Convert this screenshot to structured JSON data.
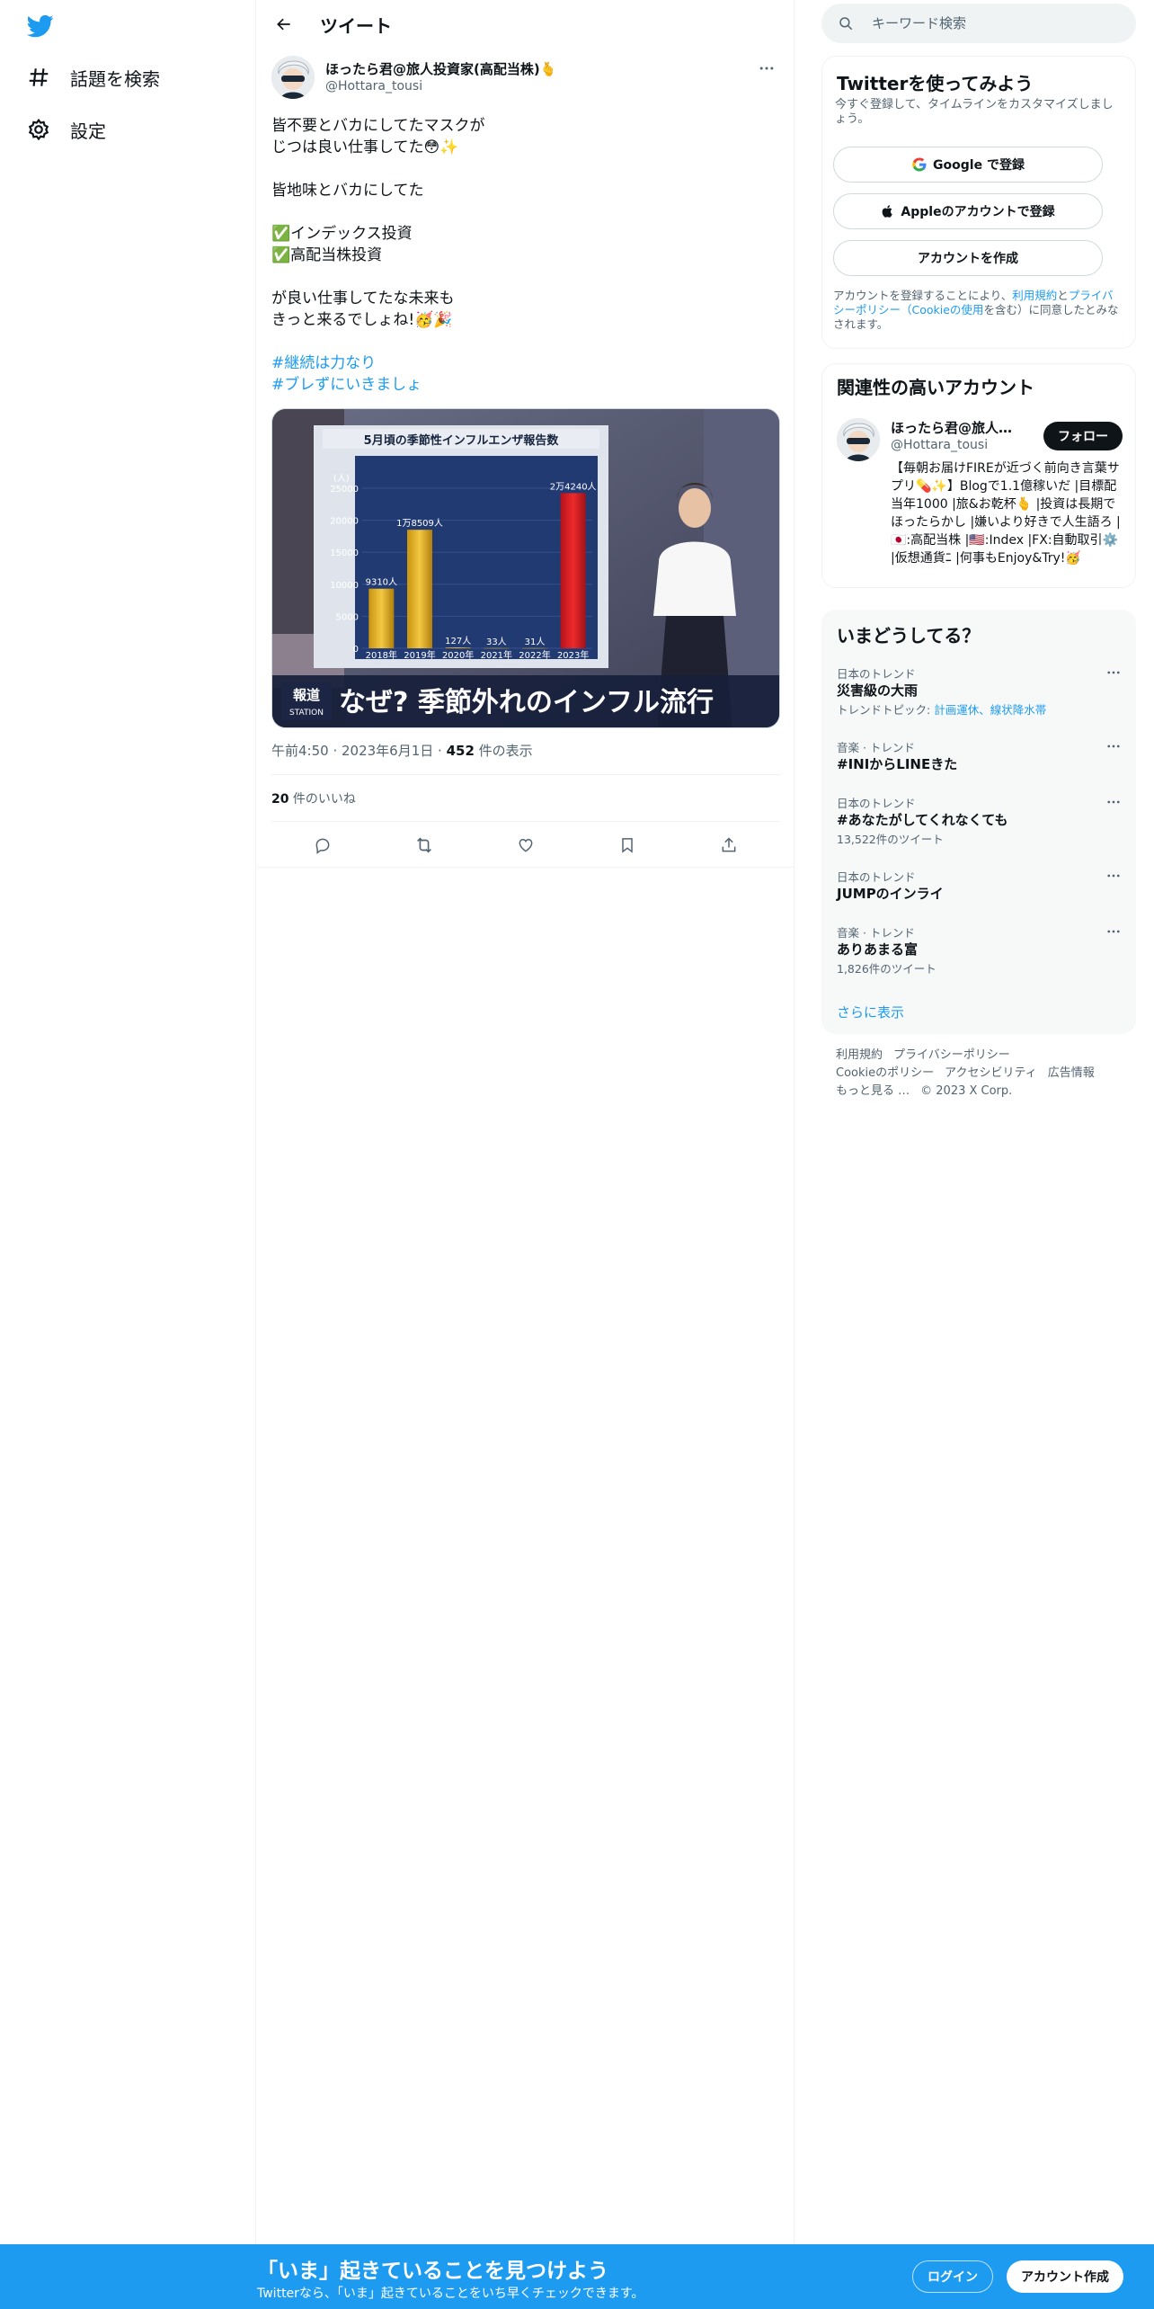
{
  "nav": {
    "explore_label": "話題を検索",
    "settings_label": "設定"
  },
  "header": {
    "title": "ツイート"
  },
  "tweet": {
    "author_name": "ほったら君@旅人投資家(高配当株)🫰",
    "author_handle": "@Hottara_tousi",
    "lines": [
      "皆不要とバカにしてたマスクが",
      "じつは良い仕事してた😳✨",
      "",
      "皆地味とバカにしてた",
      "",
      "✅インデックス投資",
      "✅高配当株投資",
      "",
      "が良い仕事してたな未来も",
      "きっと来るでしょね!🥳🎉",
      ""
    ],
    "hashtags": [
      "#継続は力なり",
      "#ブレずにいきましょ"
    ],
    "media": {
      "chart_title": "5月頃の季節性インフルエンザ報告数",
      "y_unit": "(人)",
      "y_ticks": [
        "25000",
        "20000",
        "15000",
        "10000",
        "5000",
        "0"
      ],
      "years": [
        "2018年",
        "2019年",
        "2020年",
        "2021年",
        "2022年",
        "2023年"
      ],
      "labels": [
        "9310人",
        "1万8509人",
        "127人",
        "33人",
        "31人",
        "2万4240人"
      ],
      "values": [
        9310,
        18509,
        127,
        33,
        31,
        24240
      ],
      "ymax": 25000,
      "banner_logo_top": "報道",
      "banner_logo_bottom": "STATION",
      "banner_text": "なぜ? 季節外れのインフル流行"
    },
    "time": "午前4:50",
    "date": "2023年6月1日",
    "views": "452",
    "views_label": " 件の表示",
    "likes": "20",
    "likes_label": " 件のいいね"
  },
  "search": {
    "placeholder": "キーワード検索"
  },
  "signup": {
    "title": "Twitterを使ってみよう",
    "subtitle": "今すぐ登録して、タイムラインをカスタマイズしましょう。",
    "google": "Google で登録",
    "apple": "Appleのアカウントで登録",
    "create": "アカウントを作成",
    "terms_prefix": "アカウントを登録することにより、",
    "terms_link1": "利用規約",
    "terms_mid": "と",
    "terms_link2": "プライバシーポリシー（Cookieの使用",
    "terms_suffix": "を含む）に同意したとみなされます。"
  },
  "related": {
    "title": "関連性の高いアカウント",
    "name": "ほったら君@旅人投...",
    "handle": "@Hottara_tousi",
    "follow": "フォロー",
    "bio": "【毎朝お届けFIREが近づく前向き言葉サプリ💊✨】Blogで1.1億稼いだ |目標配当年1000 |旅&お乾杯🫰 |投資は長期でほったらかし |嫌いより好きで人生語ろ | 🇯🇵:高配当株 |🇺🇸:Index |FX:自動取引⚙️ |仮想通貨ﾆ |何事もEnjoy&Try!🥳"
  },
  "trends": {
    "title": "いまどうしてる？",
    "items": [
      {
        "context": "日本のトレンド",
        "name": "災害級の大雨",
        "extra_prefix": "トレンドトピック: ",
        "extra_link": "計画運休、線状降水帯"
      },
      {
        "context": "音楽 · トレンド",
        "name": "#INIからLINEきた"
      },
      {
        "context": "日本のトレンド",
        "name": "#あなたがしてくれなくても",
        "extra": "13,522件のツイート"
      },
      {
        "context": "日本のトレンド",
        "name": "JUMPのインライ"
      },
      {
        "context": "音楽 · トレンド",
        "name": "ありあまる富",
        "extra": "1,826件のツイート"
      }
    ],
    "show_more": "さらに表示"
  },
  "footer": {
    "links": [
      "利用規約",
      "プライバシーポリシー",
      "Cookieのポリシー",
      "アクセシビリティ",
      "広告情報",
      "もっと見る …"
    ],
    "copyright": "© 2023 X Corp."
  },
  "bottom": {
    "headline": "「いま」起きていることを見つけよう",
    "sub": "Twitterなら、「いま」起きていることをいち早くチェックできます。",
    "login": "ログイン",
    "signup": "アカウント作成"
  },
  "colors": {
    "accent": "#1d9bf0",
    "text": "#0f1419",
    "secondary": "#536471"
  }
}
